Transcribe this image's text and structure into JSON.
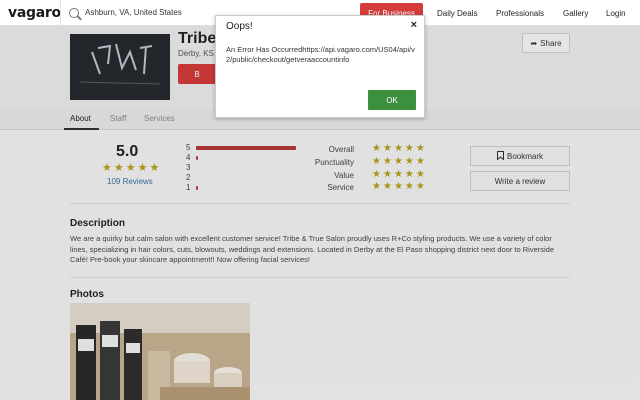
{
  "nav": {
    "logo": "vagaro",
    "search_value": "Ashburn, VA, United States",
    "for_business": "For Business",
    "daily_deals": "Daily Deals",
    "professionals": "Professionals",
    "gallery": "Gallery",
    "login": "Login"
  },
  "business": {
    "name": "Tribe",
    "location": "Derby, KS",
    "book_label": "B",
    "share_label": "Share"
  },
  "tabs": [
    "About",
    "Staff",
    "Services"
  ],
  "rating": {
    "score": "5.0",
    "reviews": "109 Reviews",
    "distribution": [
      {
        "stars": "5",
        "fraction": 1.0
      },
      {
        "stars": "4",
        "fraction": 0.02
      },
      {
        "stars": "3",
        "fraction": 0
      },
      {
        "stars": "2",
        "fraction": 0
      },
      {
        "stars": "1",
        "fraction": 0.01
      }
    ],
    "categories": [
      "Overall",
      "Punctuality",
      "Value",
      "Service"
    ]
  },
  "actions": {
    "bookmark": "Bookmark",
    "write_review": "Write a review"
  },
  "description": {
    "title": "Description",
    "text": "We are a quirky but calm salon with excellent customer service! Tribe & True Salon proudly uses R+Co styling products. We use a variety of color lines, specializing in hair colors, cuts, blowouts, weddings and extensions. Located in Derby at the El Paso shopping district next door to Riverside Café! Pre-book your skincare appointment!! Now offering facial services!"
  },
  "photos": {
    "title": "Photos"
  },
  "modal": {
    "title": "Oops!",
    "close": "×",
    "message": "An Error Has Occurredhttps://api.vagaro.com/US04/api/v2/public/checkout/getveraaccountinfo",
    "ok": "OK"
  },
  "colors": {
    "brand_red": "#d43c3c",
    "star_gold": "#b5a01a",
    "ok_green": "#3c8f3c",
    "link_blue": "#3a6fa3"
  }
}
